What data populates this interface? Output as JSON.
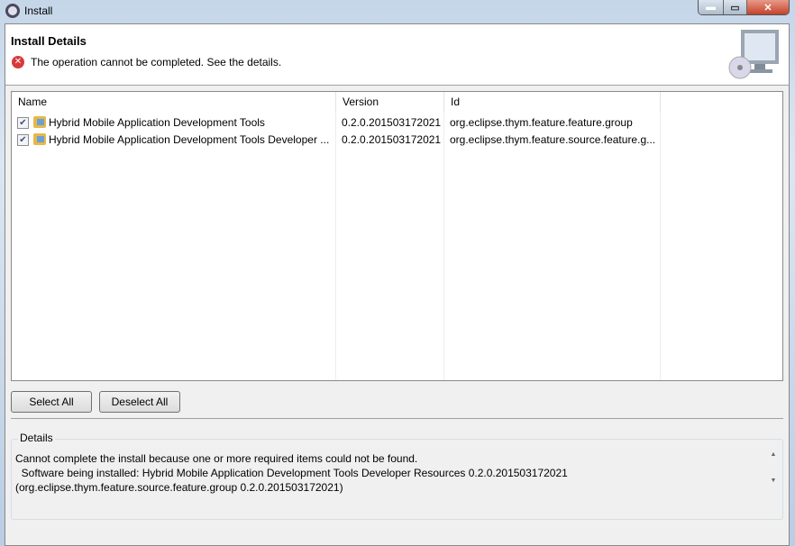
{
  "window": {
    "title": "Install"
  },
  "header": {
    "title": "Install Details",
    "message": "The operation cannot be completed.  See the details."
  },
  "table": {
    "columns": [
      "Name",
      "Version",
      "Id"
    ],
    "rows": [
      {
        "checked": true,
        "name": "Hybrid Mobile Application Development Tools",
        "version": "0.2.0.201503172021",
        "id": "org.eclipse.thym.feature.feature.group"
      },
      {
        "checked": true,
        "name": "Hybrid Mobile Application Development Tools Developer ...",
        "version": "0.2.0.201503172021",
        "id": "org.eclipse.thym.feature.source.feature.g..."
      }
    ]
  },
  "buttons": {
    "select_all": "Select All",
    "deselect_all": "Deselect All"
  },
  "details": {
    "label": "Details",
    "lines": [
      "Cannot complete the install because one or more required items could not be found.",
      "  Software being installed: Hybrid Mobile Application Development Tools Developer Resources 0.2.0.201503172021",
      "(org.eclipse.thym.feature.source.feature.group 0.2.0.201503172021)"
    ]
  }
}
